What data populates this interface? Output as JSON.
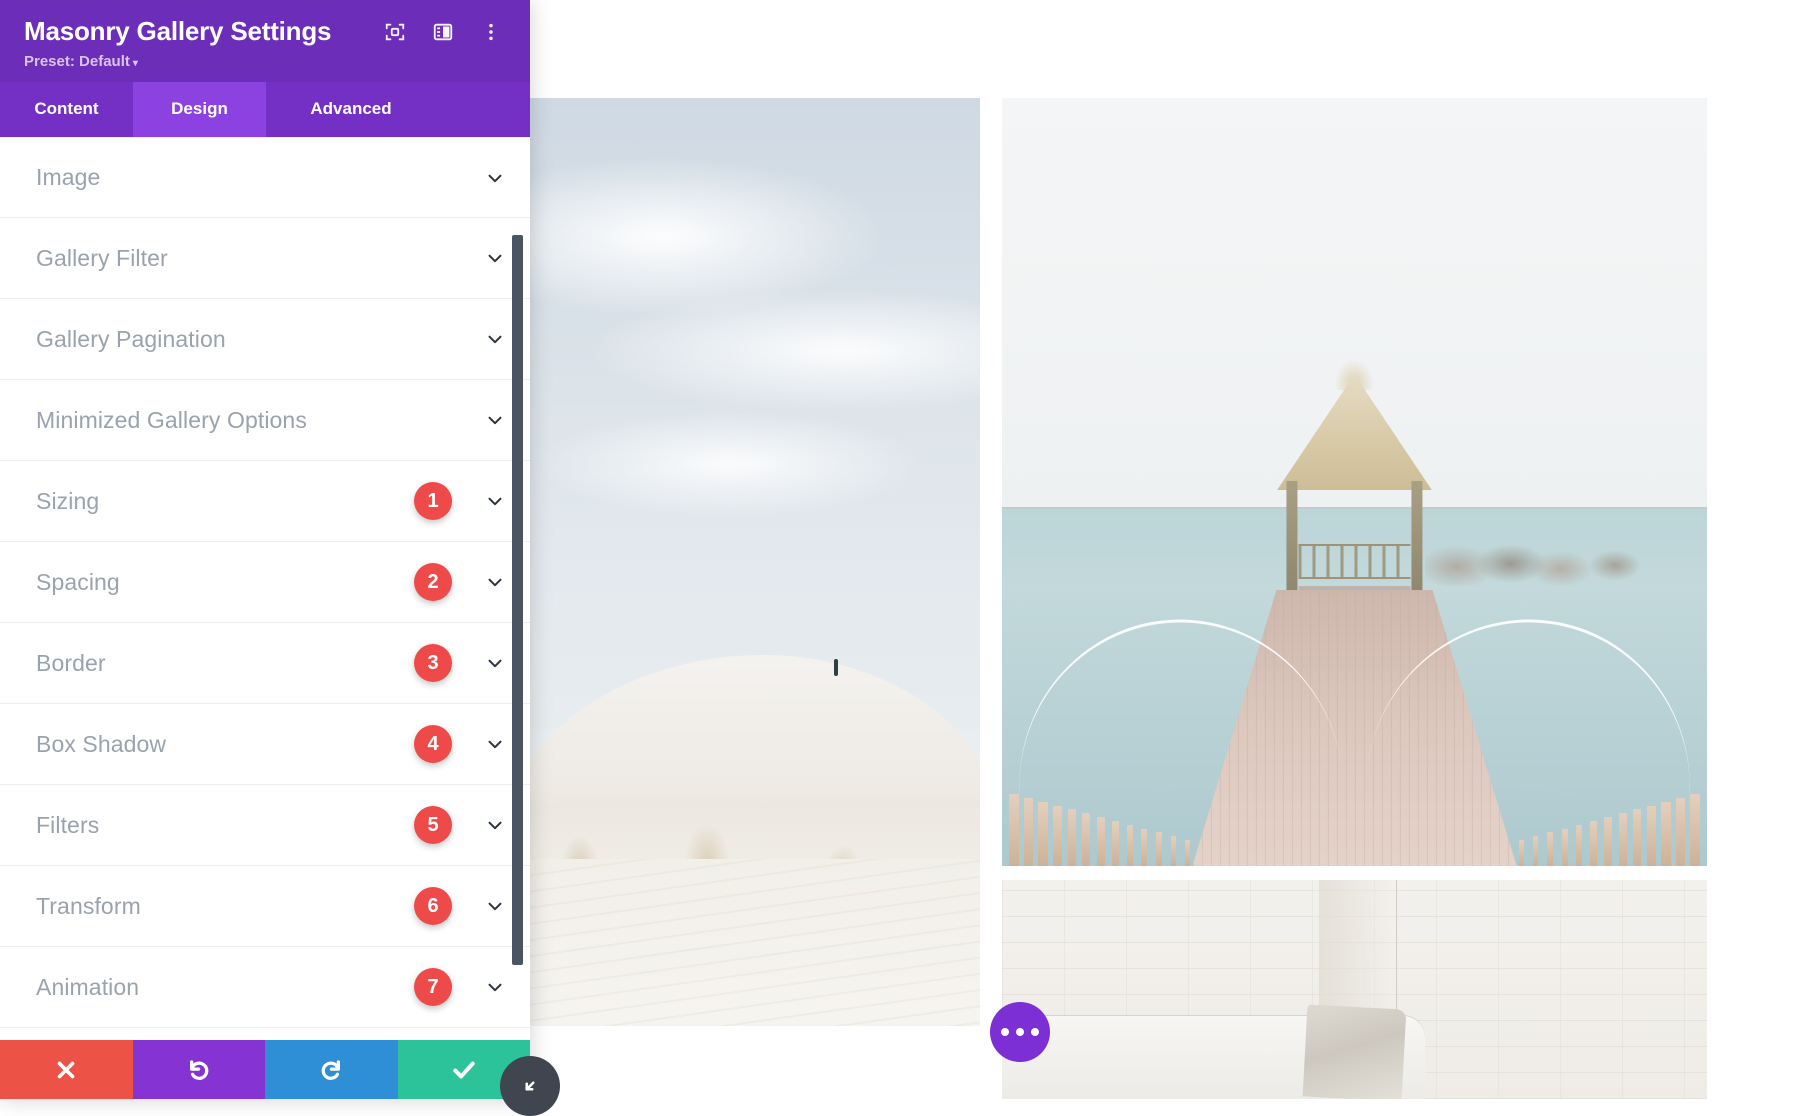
{
  "panel": {
    "title": "Masonry Gallery Settings",
    "preset_label": "Preset: Default",
    "preset_caret": "▾",
    "header_icons": [
      {
        "name": "focus-target-icon"
      },
      {
        "name": "panel-layout-icon"
      },
      {
        "name": "kebab-menu-icon"
      }
    ],
    "tabs": [
      {
        "label": "Content",
        "active": false
      },
      {
        "label": "Design",
        "active": true
      },
      {
        "label": "Advanced",
        "active": false
      }
    ],
    "sections": [
      {
        "label": "Image",
        "badge": ""
      },
      {
        "label": "Gallery Filter",
        "badge": ""
      },
      {
        "label": "Gallery Pagination",
        "badge": ""
      },
      {
        "label": "Minimized Gallery Options",
        "badge": ""
      },
      {
        "label": "Sizing",
        "badge": "1"
      },
      {
        "label": "Spacing",
        "badge": "2"
      },
      {
        "label": "Border",
        "badge": "3"
      },
      {
        "label": "Box Shadow",
        "badge": "4"
      },
      {
        "label": "Filters",
        "badge": "5"
      },
      {
        "label": "Transform",
        "badge": "6"
      },
      {
        "label": "Animation",
        "badge": "7"
      }
    ],
    "actions": [
      {
        "name": "cancel-button",
        "icon": "close-icon",
        "color": "#ec5245"
      },
      {
        "name": "undo-button",
        "icon": "undo-icon",
        "color": "#8633d4"
      },
      {
        "name": "redo-button",
        "icon": "redo-icon",
        "color": "#2e8fd6"
      },
      {
        "name": "save-button",
        "icon": "checkmark-icon",
        "color": "#2dc39a"
      }
    ],
    "colors": {
      "header_purple": "#6c2eb9",
      "tabbar_purple": "#7430c4",
      "active_tab_purple": "#8b42e0",
      "badge_red": "#ef4a4a",
      "label_gray": "#9aa2ad",
      "scrollbar": "#4a5562"
    }
  },
  "canvas": {
    "more_button_label": "•••",
    "gallery_images": [
      {
        "name": "white-sand-dunes-photo"
      },
      {
        "name": "pier-gazebo-ocean-photo"
      },
      {
        "name": "white-brick-wall-couch-photo"
      }
    ],
    "resize_handle": {
      "name": "resize-handle-icon"
    }
  }
}
